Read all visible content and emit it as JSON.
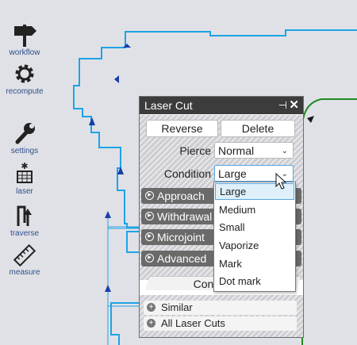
{
  "toolbar": {
    "items": [
      {
        "label": "workflow",
        "icon": "signpost-icon"
      },
      {
        "label": "recompute",
        "icon": "gear-icon"
      },
      {
        "label": "settings",
        "icon": "wrench-icon"
      },
      {
        "label": "laser",
        "icon": "laser-icon"
      },
      {
        "label": "traverse",
        "icon": "traverse-icon"
      },
      {
        "label": "measure",
        "icon": "ruler-icon"
      }
    ]
  },
  "panel": {
    "title": "Laser Cut",
    "pin_glyph": "⊣",
    "close_glyph": "✕",
    "reverse_label": "Reverse",
    "delete_label": "Delete",
    "pierce_label": "Pierce",
    "pierce_value": "Normal",
    "condition_label": "Condition",
    "condition_value": "Large",
    "sections": [
      "Approach",
      "Withdrawal",
      "Microjoint",
      "Advanced"
    ],
    "con_label": "Con",
    "links": [
      "Similar",
      "All Laser Cuts"
    ]
  },
  "dropdown": {
    "options": [
      "Large",
      "Medium",
      "Small",
      "Vaporize",
      "Mark",
      "Dot mark"
    ],
    "selected": "Large"
  },
  "colors": {
    "path_blue": "#1ea3e6",
    "arrow_blue": "#1a3ea8",
    "path_green": "#1f8a1f",
    "panel_header": "#3c3c3c",
    "section_bar": "#6a6a6a"
  }
}
